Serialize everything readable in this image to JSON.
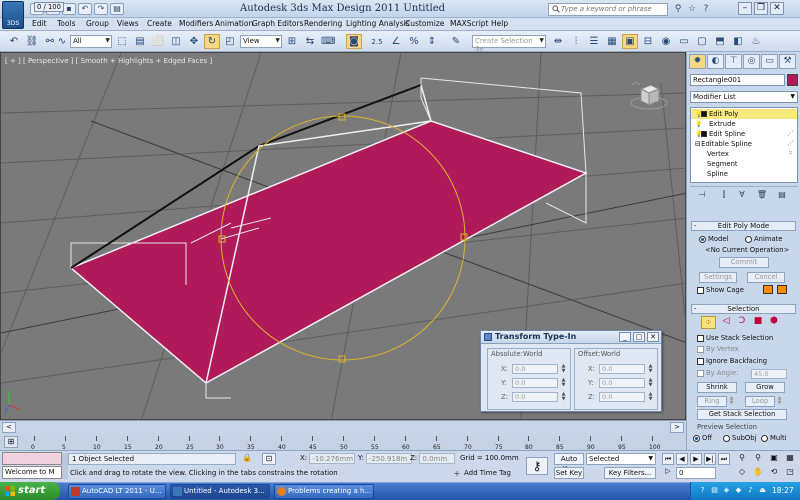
{
  "window": {
    "title": "Autodesk 3ds Max Design 2011      Untitled",
    "logo_label": "3DS",
    "search_placeholder": "Type a keyword or phrase"
  },
  "menu": [
    "Edit",
    "Tools",
    "Group",
    "Views",
    "Create",
    "Modifiers",
    "Animation",
    "Graph Editors",
    "Rendering",
    "Lighting Analysis",
    "Customize",
    "MAXScript",
    "Help"
  ],
  "toolbar": {
    "selection_filter": "All",
    "reference_coord": "View",
    "named_selection_placeholder": "Create Selection Se",
    "snap_label": "2.5"
  },
  "viewport": {
    "label": "[ + ] [ Perspective ] [ Smooth + Highlights + Edged Faces ]",
    "object_color": "#b0195a",
    "background": "#7a7a7a"
  },
  "command_panel": {
    "object_name": "Rectangle001",
    "object_color": "#b0195a",
    "modifier_list_label": "Modifier List",
    "stack": [
      {
        "label": "Edit Poly",
        "type": "modifier",
        "selected": true
      },
      {
        "label": "Extrude",
        "type": "modifier",
        "selected": false
      },
      {
        "label": "Edit Spline",
        "type": "modifier",
        "selected": false
      },
      {
        "label": "Editable Spline",
        "type": "base",
        "selected": false
      },
      {
        "label": "Vertex",
        "type": "sub",
        "selected": false
      },
      {
        "label": "Segment",
        "type": "sub",
        "selected": false
      },
      {
        "label": "Spline",
        "type": "sub",
        "selected": false
      }
    ],
    "edit_poly_mode": {
      "title": "Edit Poly Mode",
      "model_label": "Model",
      "animate_label": "Animate",
      "current_op": "<No Current Operation>",
      "commit_label": "Commit",
      "settings_label": "Settings",
      "cancel_label": "Cancel",
      "show_cage_label": "Show Cage",
      "cage_color_1": "#ff8c00",
      "cage_color_2": "#ff8c00"
    },
    "selection": {
      "title": "Selection",
      "use_stack_label": "Use Stack Selection",
      "by_vertex_label": "By Vertex",
      "ignore_backfacing_label": "Ignore Backfacing",
      "by_angle_label": "By Angle:",
      "by_angle_value": "45.0",
      "shrink_label": "Shrink",
      "grow_label": "Grow",
      "ring_label": "Ring",
      "loop_label": "Loop",
      "get_stack_label": "Get Stack Selection",
      "preview_label": "Preview Selection",
      "off_label": "Off",
      "subobj_label": "SubObj",
      "multi_label": "Multi"
    }
  },
  "transform_dialog": {
    "title": "Transform Type-In",
    "absolute_title": "Absolute:World",
    "offset_title": "Offset:World",
    "absolute": [
      {
        "axis": "X:",
        "value": "0.0"
      },
      {
        "axis": "Y:",
        "value": "0.0"
      },
      {
        "axis": "Z:",
        "value": "0.0"
      }
    ],
    "offset": [
      {
        "axis": "X:",
        "value": "0.0"
      },
      {
        "axis": "Y:",
        "value": "0.0"
      },
      {
        "axis": "Z:",
        "value": "0.0"
      }
    ]
  },
  "timeline": {
    "frame_display": "0 / 100",
    "ticks": [
      "0",
      "5",
      "10",
      "15",
      "20",
      "25",
      "30",
      "35",
      "40",
      "45",
      "50",
      "55",
      "60",
      "65",
      "70",
      "75",
      "80",
      "85",
      "90",
      "95",
      "100"
    ]
  },
  "status": {
    "welcome": "Welcome to M",
    "selection": "1 Object Selected",
    "prompt": "Click and drag to rotate the view.  Clicking in the tabs constrains the rotation",
    "x_value": "-10.276mm",
    "y_value": "-250.918m",
    "z_value": "0.0mm",
    "grid": "Grid = 100.0mm",
    "add_time_tag": "Add Time Tag",
    "auto_key": "Auto Key",
    "set_key": "Set Key",
    "key_mode": "Selected",
    "key_filters": "Key Filters...",
    "frame_value": "0"
  },
  "taskbar": {
    "start_label": "start",
    "tasks": [
      {
        "label": "AutoCAD LT 2011 - U...",
        "active": false
      },
      {
        "label": "Untitled - Autodesk 3...",
        "active": true
      },
      {
        "label": "Problems creating a h...",
        "active": false
      }
    ],
    "clock": "18:27"
  }
}
